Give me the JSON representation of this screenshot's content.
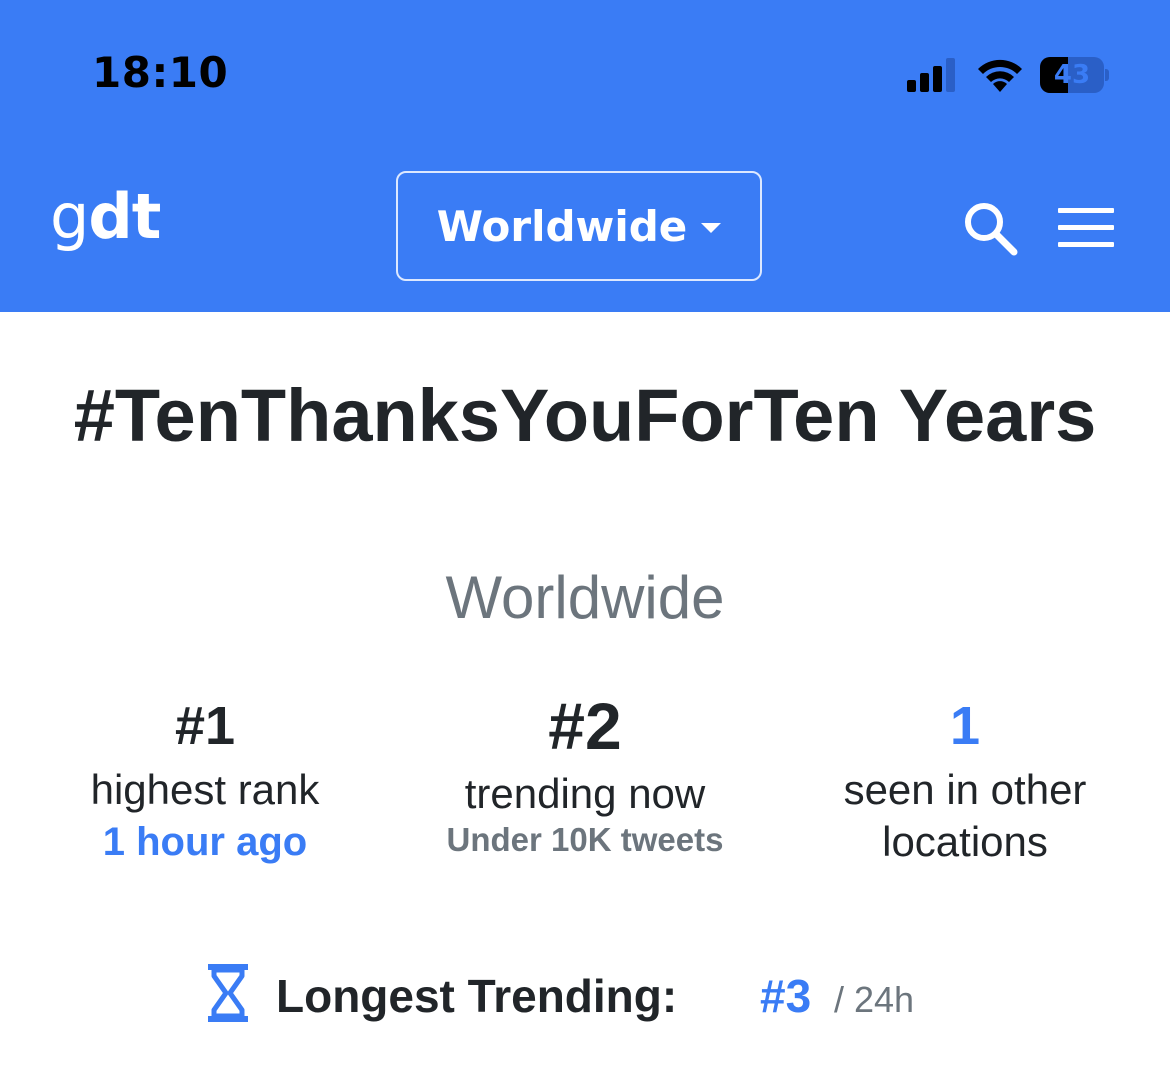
{
  "status_bar": {
    "time": "18:10",
    "battery_level": "43",
    "battery_fraction": 0.43
  },
  "header": {
    "logo_part1": "g",
    "logo_part2": "dt",
    "location_label": "Worldwide",
    "background_color": "#3a7cf5"
  },
  "trend": {
    "title": "#TenThanksYouForTen Years",
    "location": "Worldwide"
  },
  "stats": [
    {
      "value": "#1",
      "label": "highest rank",
      "sub": "1 hour ago"
    },
    {
      "value": "#2",
      "label": "trending now",
      "note": "Under 10K tweets"
    },
    {
      "value": "1",
      "label": "seen in other locations"
    }
  ],
  "longest_trending": {
    "label": "Longest Trending:",
    "rank": "#3",
    "period": "/ 24h"
  },
  "icons": [
    "signal-icon",
    "wifi-icon",
    "battery-icon",
    "caret-icon",
    "search-icon",
    "menu-icon",
    "hourglass-icon"
  ],
  "accent_color": "#3a7cf5"
}
